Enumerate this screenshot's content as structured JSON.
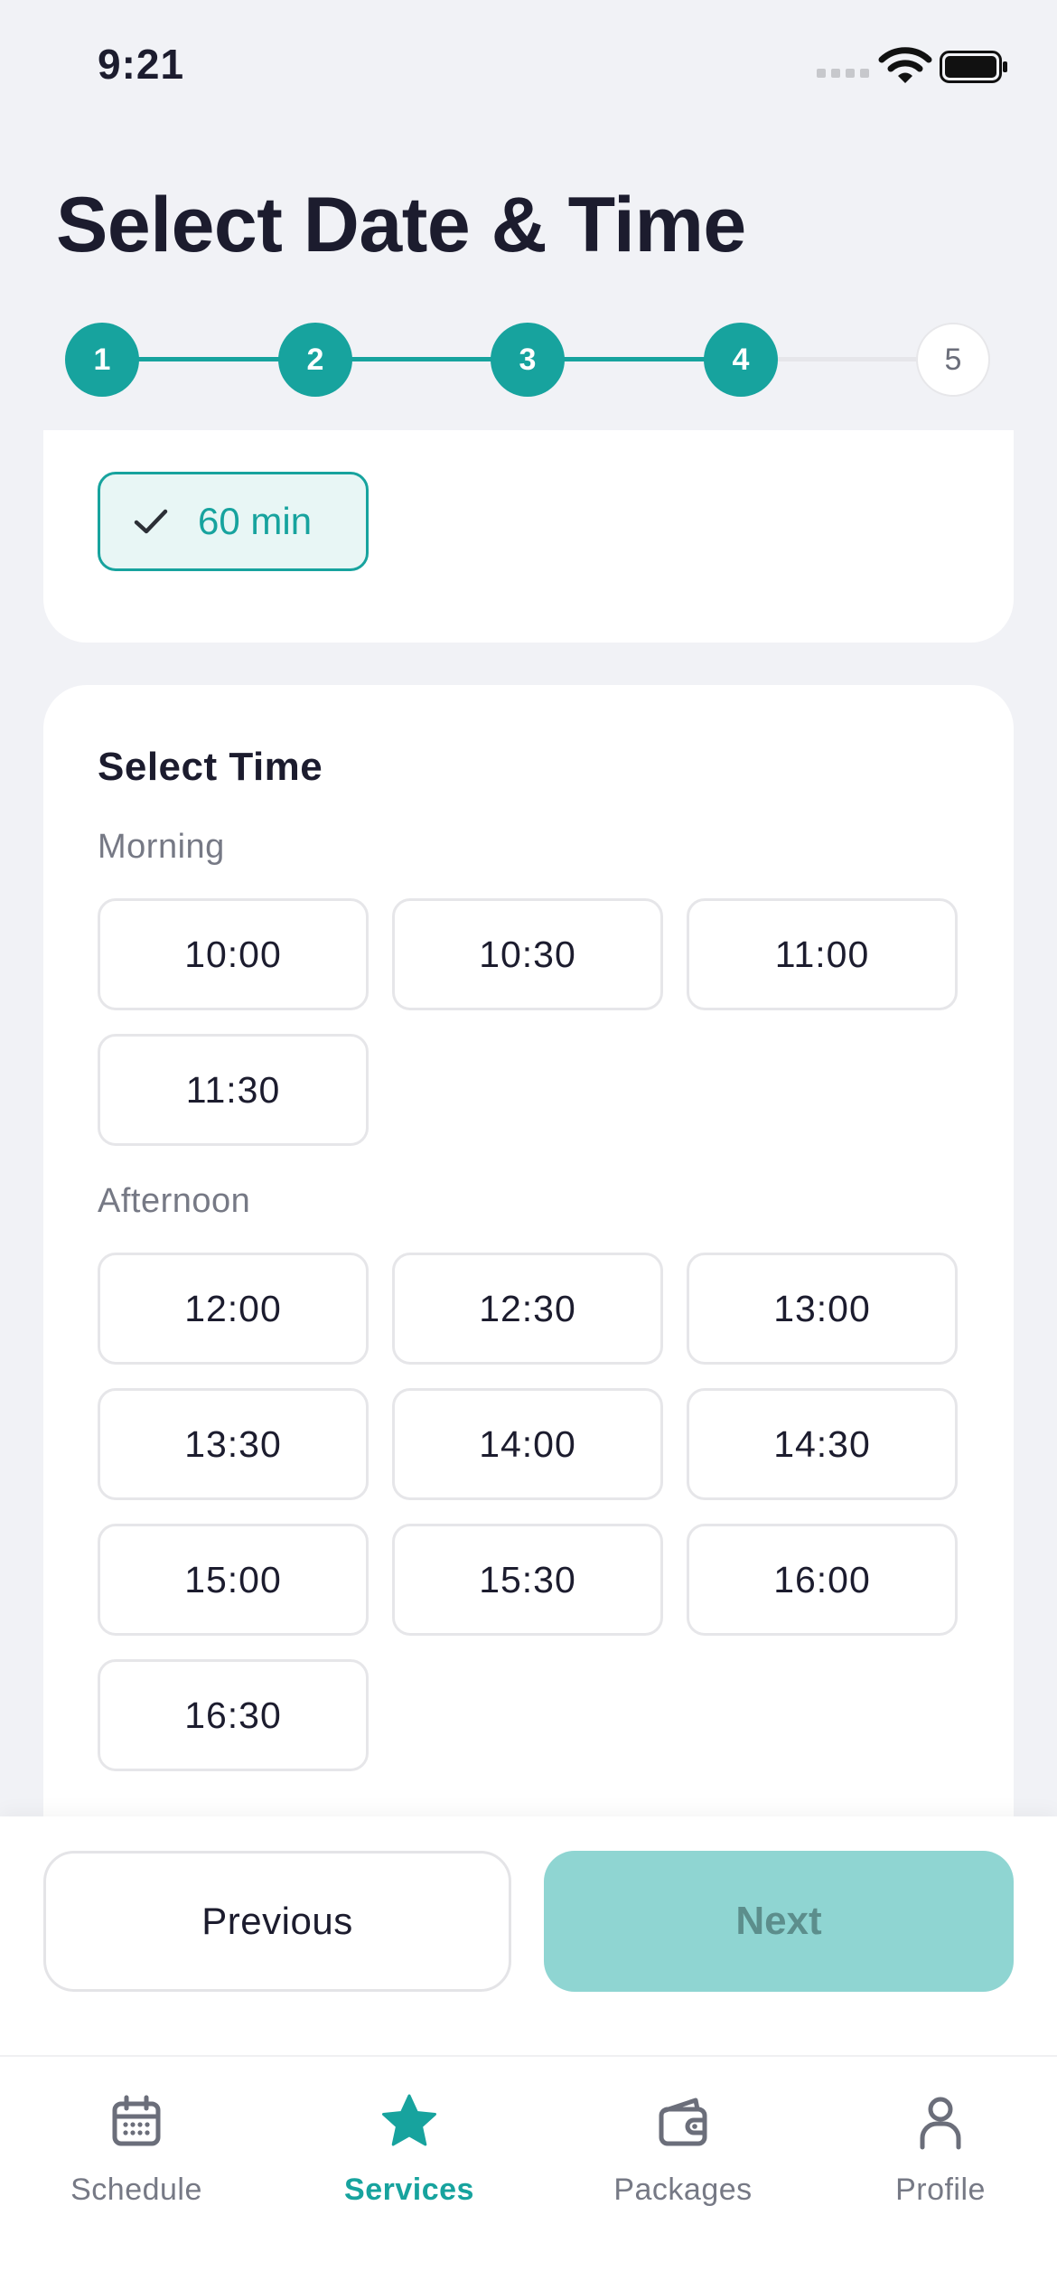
{
  "status_bar": {
    "time": "9:21"
  },
  "header": {
    "title": "Select Date & Time"
  },
  "stepper": {
    "steps": [
      {
        "label": "1",
        "state": "done"
      },
      {
        "label": "2",
        "state": "done"
      },
      {
        "label": "3",
        "state": "done"
      },
      {
        "label": "4",
        "state": "done"
      },
      {
        "label": "5",
        "state": "todo"
      }
    ]
  },
  "duration": {
    "selected": "60 min"
  },
  "time_card": {
    "title": "Select Time",
    "morning_label": "Morning",
    "morning_slots": [
      "10:00",
      "10:30",
      "11:00",
      "11:30"
    ],
    "afternoon_label": "Afternoon",
    "afternoon_slots": [
      "12:00",
      "12:30",
      "13:00",
      "13:30",
      "14:00",
      "14:30",
      "15:00",
      "15:30",
      "16:00",
      "16:30"
    ]
  },
  "actions": {
    "previous": "Previous",
    "next": "Next"
  },
  "tabs": [
    {
      "label": "Schedule",
      "icon": "calendar-icon",
      "active": false
    },
    {
      "label": "Services",
      "icon": "star-icon",
      "active": true
    },
    {
      "label": "Packages",
      "icon": "wallet-icon",
      "active": false
    },
    {
      "label": "Profile",
      "icon": "person-icon",
      "active": false
    }
  ],
  "colors": {
    "accent": "#17a39e",
    "next_disabled": "#8fd5d2",
    "background": "#f1f2f6"
  }
}
